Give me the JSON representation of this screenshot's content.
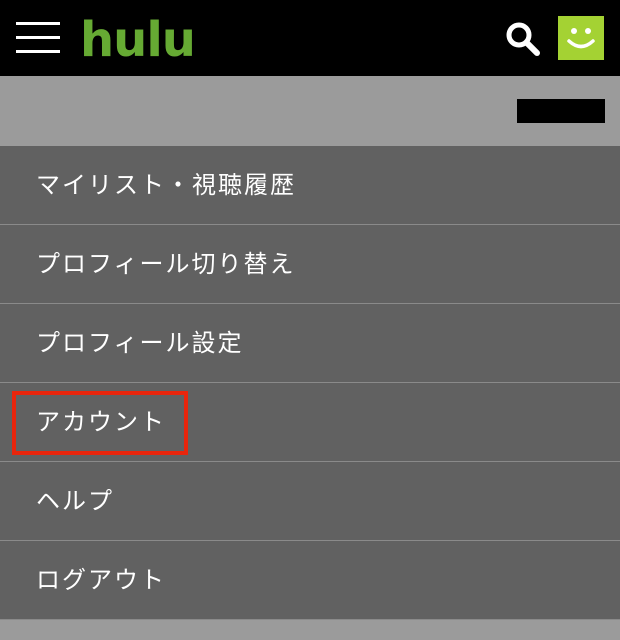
{
  "header": {
    "logo_text": "hulu",
    "logo_color": "#66aa33",
    "menu_icon": "hamburger-icon",
    "search_icon": "search-icon",
    "avatar_icon": "smiley-avatar-icon",
    "avatar_color": "#a4d233"
  },
  "menu": {
    "items": [
      {
        "label": "マイリスト・視聴履歴"
      },
      {
        "label": "プロフィール切り替え"
      },
      {
        "label": "プロフィール設定"
      },
      {
        "label": "アカウント",
        "highlighted": true,
        "highlight_color": "#e8250c"
      },
      {
        "label": "ヘルプ"
      },
      {
        "label": "ログアウト"
      }
    ]
  }
}
